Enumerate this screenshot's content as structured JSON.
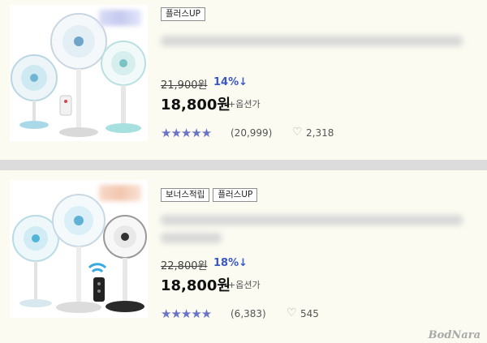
{
  "products": [
    {
      "badges": [
        "플러스UP"
      ],
      "original_price": "21,900원",
      "discount": "14%↓",
      "price": "18,800원",
      "option_note": "+옵션가",
      "stars": "★★★★★",
      "reviews": "(20,999)",
      "heart_icon": "♡",
      "likes": "2,318"
    },
    {
      "badges": [
        "보너스적립",
        "플러스UP"
      ],
      "original_price": "22,800원",
      "discount": "18%↓",
      "price": "18,800원",
      "option_note": "+옵션가",
      "stars": "★★★★★",
      "reviews": "(6,383)",
      "heart_icon": "♡",
      "likes": "545"
    }
  ],
  "watermark": "BodNara",
  "colors": {
    "discount": "#3a57c8",
    "stars": "#6a74c6",
    "card_bg": "#fbfbf2"
  }
}
